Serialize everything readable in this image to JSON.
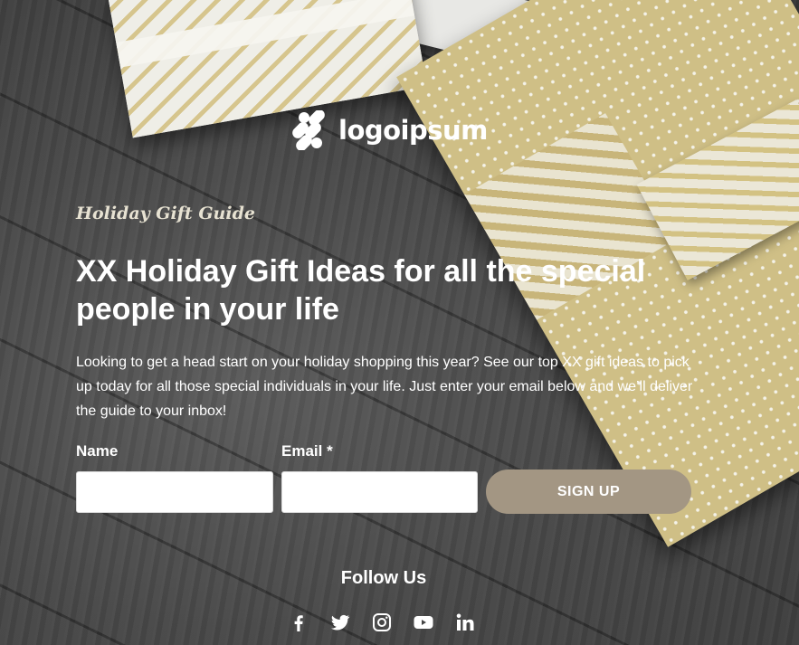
{
  "logo": {
    "text": "logoipsum"
  },
  "hero": {
    "kicker": "Holiday Gift Guide",
    "headline": "XX Holiday Gift Ideas for all the special people in your life",
    "description": "Looking to get a head start on your holiday shopping this year? See our top XX gift ideas to pick up today for all those special individuals in your life. Just enter your email below and we’ll deliver the guide to your inbox!"
  },
  "form": {
    "name_label": "Name",
    "name_value": "",
    "email_label": "Email *",
    "email_value": "",
    "submit_label": "SIGN UP",
    "button_color": "#a39683"
  },
  "footer": {
    "follow_label": "Follow Us",
    "social_icons": [
      "facebook-icon",
      "twitter-icon",
      "instagram-icon",
      "youtube-icon",
      "linkedin-icon"
    ]
  }
}
